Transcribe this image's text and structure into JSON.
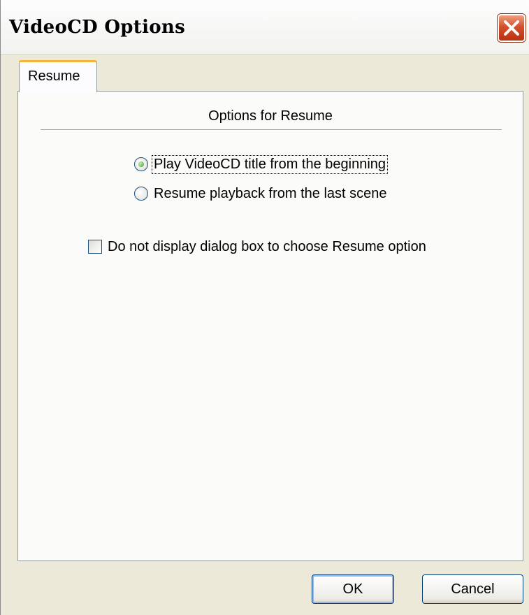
{
  "window": {
    "title": "VideoCD Options",
    "close_icon": "close-icon"
  },
  "tabs": [
    {
      "label": "Resume",
      "selected": true
    }
  ],
  "resume": {
    "section_title": "Options for Resume",
    "options": [
      {
        "label": "Play VideoCD title from the beginning",
        "checked": true
      },
      {
        "label": "Resume playback from the last scene",
        "checked": false
      }
    ],
    "checkbox": {
      "label": "Do not display dialog box to choose Resume option",
      "checked": false
    }
  },
  "buttons": {
    "ok_label": "OK",
    "cancel_label": "Cancel"
  },
  "colors": {
    "dialog_bg": "#ece9d8",
    "tab_accent": "#f4b43c",
    "close_red": "#d4502c",
    "radio_green": "#3c9c2c"
  }
}
